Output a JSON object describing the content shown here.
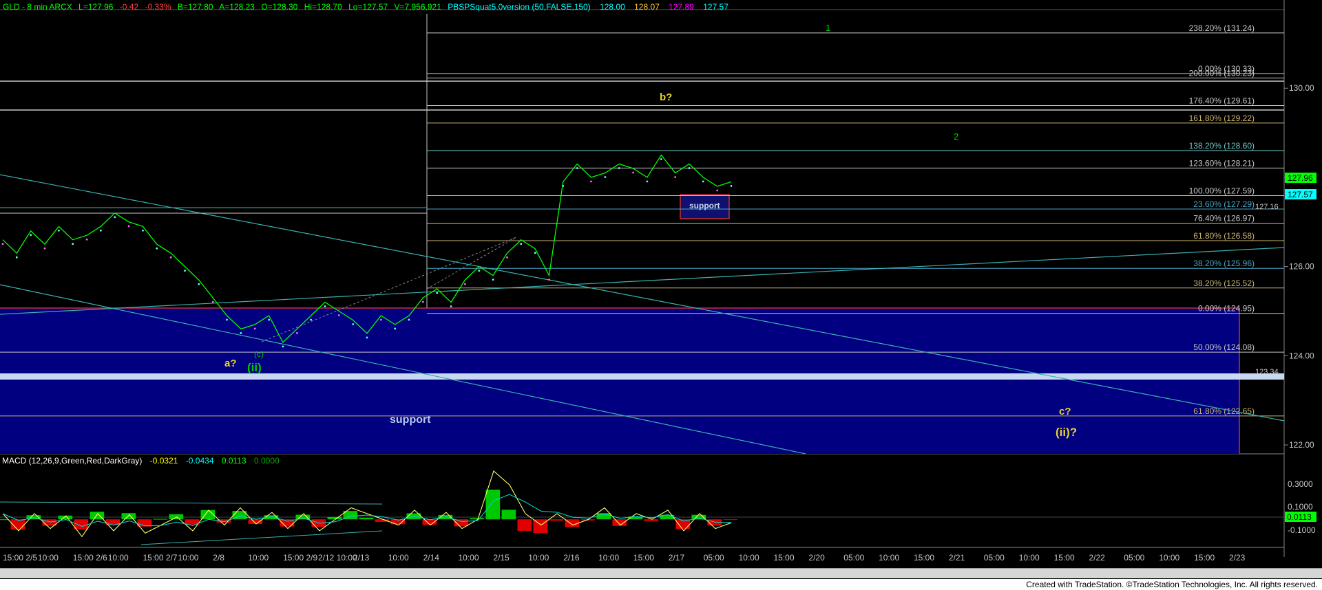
{
  "header": {
    "symbol": "GLD - 8 min  ARCX",
    "last": "L=127.96",
    "change": "-0.42",
    "pct": "-0.33%",
    "bid": "B=127.80",
    "ask": "A=128.23",
    "open": "O=128.30",
    "hi": "Hi=128.70",
    "lo": "Lo=127.57",
    "vol": "V=7,956,921",
    "study": "PBSPSquat5.0version (50,FALSE,150)",
    "study_values": [
      "128.00",
      "128.07",
      "127.89",
      "127.57"
    ],
    "study_colors": [
      "#00ffff",
      "#ffcc33",
      "#ff00ff",
      "#00ffff"
    ]
  },
  "macd_header": {
    "name": "MACD (12,26,9,Green,Red,DarkGray)",
    "values": [
      "-0.0321",
      "-0.0434",
      "0.0113",
      "0.0000"
    ],
    "colors": [
      "#ffff00",
      "#00ffff",
      "#00ff00",
      "#00aa00"
    ]
  },
  "price_axis": {
    "ticks": [
      "130.00",
      "128.00",
      "126.00",
      "124.00",
      "122.00"
    ],
    "badges": [
      {
        "label": "127.96",
        "color": "#00ff00",
        "text_color": "#000"
      },
      {
        "label": "127.57",
        "color": "#00ffff",
        "text_color": "#000"
      }
    ],
    "aux_labels": [
      "127.16",
      "123.34"
    ]
  },
  "macd_axis": {
    "ticks": [
      "0.3000",
      "0.1000",
      "-0.1000"
    ],
    "badge": "0.0113"
  },
  "time_axis": {
    "labels": [
      "15:00 2/5",
      "10:00",
      "15:00 2/6",
      "10:00",
      "15:00 2/7",
      "10:00",
      "2/8",
      "10:00",
      "15:00 2/9",
      "2/12 10:00",
      "2/13",
      "10:00",
      "2/14",
      "10:00",
      "2/15",
      "10:00",
      "2/16",
      "10:00",
      "15:00",
      "2/17",
      "05:00",
      "10:00",
      "15:00",
      "2/20",
      "05:00",
      "10:00",
      "15:00",
      "2/21",
      "05:00",
      "10:00",
      "15:00",
      "2/22",
      "05:00",
      "10:00",
      "15:00",
      "2/23"
    ]
  },
  "fib_levels": [
    {
      "label": "238.20% (131.24)",
      "color": "#c8c8c8"
    },
    {
      "label": "200.00% (130.23)",
      "color": "#c8c8c8"
    },
    {
      "label": "0.00% (130.33)",
      "color": "#c8c8c8"
    },
    {
      "label": "176.40% (129.61)",
      "color": "#c8c8c8"
    },
    {
      "label": "161.80% (129.22)",
      "color": "#c8b46e"
    },
    {
      "label": "138.20% (128.60)",
      "color": "#6ec8c8"
    },
    {
      "label": "123.60% (128.21)",
      "color": "#c8c8c8"
    },
    {
      "label": "100.00% (127.59)",
      "color": "#c8c8c8"
    },
    {
      "label": "23.60% (127.29)",
      "color": "#4aa6c8"
    },
    {
      "label": "76.40% (126.97)",
      "color": "#c8c8c8"
    },
    {
      "label": "61.80% (126.58)",
      "color": "#c8b46e"
    },
    {
      "label": "38.20% (125.96)",
      "color": "#4aa6c8"
    },
    {
      "label": "38.20% (125.52)",
      "color": "#c8b46e"
    },
    {
      "label": "0.00% (124.95)",
      "color": "#c8c8c8"
    },
    {
      "label": "50.00% (124.08)",
      "color": "#c8c8c8"
    },
    {
      "label": "61.80% (122.65)",
      "color": "#c8b46e"
    }
  ],
  "annotations": {
    "wave_1": "1",
    "wave_2": "2",
    "b_question": "b?",
    "a_question": "a?",
    "c_small": "(c)",
    "ii_label": "(ii)",
    "c_question": "c?",
    "ii_question": "(ii)?",
    "support_large": "support",
    "support_small": "support"
  },
  "footer": {
    "text": "Created with TradeStation. ©TradeStation Technologies, Inc. All rights reserved."
  },
  "chart_data": {
    "type": "line",
    "title": "GLD - 8 min ARCX",
    "series": [
      {
        "values": [
          126.6,
          126.3,
          126.8,
          126.5,
          126.9,
          126.6,
          126.7,
          126.9,
          127.2,
          127.0,
          126.9,
          126.5,
          126.3,
          126.0,
          125.7,
          125.3,
          124.9,
          124.6,
          124.7,
          124.9,
          124.3,
          124.6,
          124.9,
          125.2,
          125.0,
          124.8,
          124.5,
          124.9,
          124.7,
          124.9,
          125.3,
          125.5,
          125.2,
          125.7,
          126.0,
          125.8,
          126.3,
          126.6,
          126.4,
          125.8,
          127.9,
          128.3,
          128.0,
          128.1,
          128.3,
          128.2,
          128.0,
          128.5,
          128.1,
          128.3,
          128.0,
          127.8,
          127.9
        ]
      }
    ],
    "ylim": [
      121.8,
      131.7
    ],
    "y_ticks": [
      130,
      128,
      126,
      124,
      122
    ],
    "macd": {
      "macd_values": [
        0.05,
        -0.1,
        0.05,
        -0.08,
        0.03,
        -0.15,
        0.05,
        -0.1,
        0.04,
        -0.12,
        -0.05,
        0.02,
        -0.1,
        0.08,
        -0.05,
        0.1,
        -0.04,
        0.06,
        -0.08,
        0.05,
        -0.1,
        0.0,
        0.1,
        0.05,
        0.0,
        -0.05,
        0.08,
        -0.05,
        0.06,
        -0.08,
        0.0,
        0.42,
        0.3,
        0.05,
        -0.05,
        0.05,
        -0.05,
        0.0,
        0.1,
        -0.05,
        0.05,
        0.0,
        0.08,
        -0.1,
        0.05,
        -0.08,
        -0.03
      ],
      "ylim": [
        -0.22,
        0.45
      ]
    }
  }
}
